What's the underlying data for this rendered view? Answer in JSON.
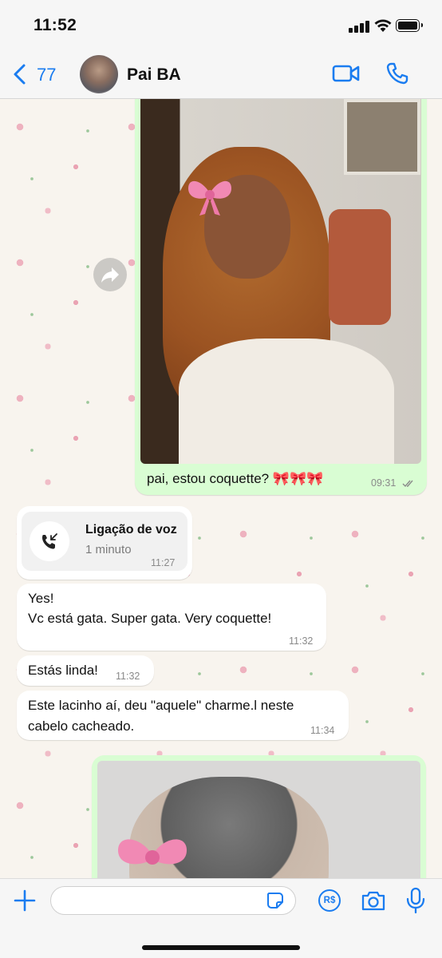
{
  "status_bar": {
    "time": "11:52"
  },
  "header": {
    "back_count": "77",
    "contact_name": "Pai BA"
  },
  "messages": {
    "photo_message": {
      "caption": "pai, estou coquette? 🎀🎀🎀",
      "time": "09:31"
    },
    "call": {
      "title": "Ligação de voz",
      "duration": "1 minuto",
      "time": "11:27"
    },
    "msg1": {
      "line1": "Yes!",
      "line2": "Vc está gata. Super gata. Very coquette!",
      "time": "11:32"
    },
    "msg2": {
      "text": "Estás linda!",
      "time": "11:32"
    },
    "msg3": {
      "line1": "Este lacinho aí, deu \"aquele\" charme.l neste",
      "line2": "cabelo cacheado.",
      "time": "11:34"
    }
  },
  "input_bar": {
    "payment_label": "R$",
    "placeholder": ""
  },
  "colors": {
    "accent": "#1a7cf0",
    "outgoing_bubble": "#d9fdd3",
    "incoming_bubble": "#ffffff"
  }
}
